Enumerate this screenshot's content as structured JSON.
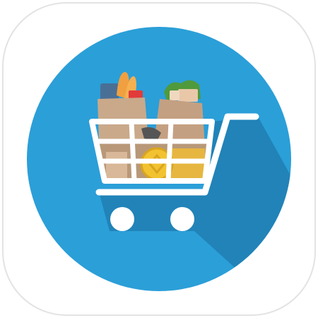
{
  "app_icon": {
    "name": "shopping-cart-app-icon",
    "colors": {
      "tile": "#ffffff",
      "tile_border": "#e3e3e3",
      "circle": "#2b9fd8",
      "shadow": "#2183b8",
      "cart": "#ffffff",
      "bag": "#c9a98a",
      "coin": "#f2c230",
      "bread": "#f0a040",
      "greens": "#4f9a3c"
    }
  }
}
